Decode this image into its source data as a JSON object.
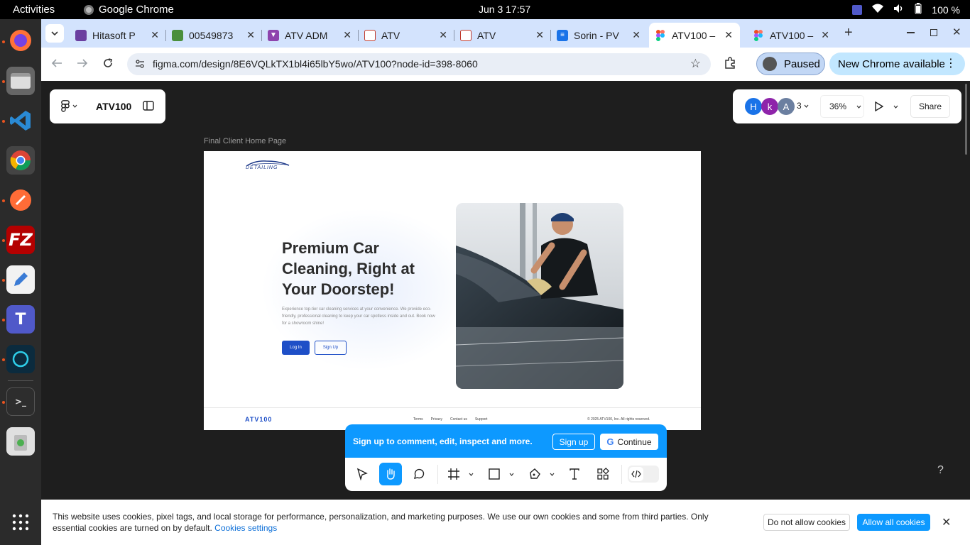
{
  "system": {
    "activities": "Activities",
    "app_name": "Google Chrome",
    "clock": "Jun 3  17:57",
    "battery": "100 %"
  },
  "tabs": [
    {
      "title": "Hitasoft P",
      "color": "#6b3fa0",
      "icon": "hitasoft-icon"
    },
    {
      "title": "00549873",
      "color": "#4a8f3c",
      "icon": "puzzle-icon"
    },
    {
      "title": "ATV ADM",
      "color": "#8e44ad",
      "icon": "vite-icon"
    },
    {
      "title": "ATV",
      "color": "#c0392b",
      "icon": "atv-icon"
    },
    {
      "title": "ATV",
      "color": "#c0392b",
      "icon": "atv-icon"
    },
    {
      "title": "Sorin - PV",
      "color": "#1a73e8",
      "icon": "docs-icon"
    },
    {
      "title": "ATV100 –",
      "color": "#f24e1e",
      "icon": "figma-icon"
    },
    {
      "title": "ATV100 –",
      "color": "#f24e1e",
      "icon": "figma-icon"
    }
  ],
  "address_bar": {
    "url": "figma.com/design/8E6VQLkTX1bl4i65lbY5wo/ATV100?node-id=398-8060"
  },
  "profile": {
    "paused_label": "Paused",
    "update_label": "New Chrome available"
  },
  "figma": {
    "file_name": "ATV100",
    "avatars": [
      {
        "letter": "H",
        "color": "#1a73e8"
      },
      {
        "letter": "k",
        "color": "#8e24aa"
      },
      {
        "letter": "A",
        "color": "#6b7fa0"
      }
    ],
    "avatar_count": "3",
    "zoom": "36%",
    "share_label": "Share",
    "help": "?"
  },
  "design_frame": {
    "label": "Final Client Home Page",
    "logo_text": "DETAILING",
    "hero_title": "Premium Car Cleaning, Right at Your Doorstep!",
    "hero_text": "Experience top-tier car cleaning services at your convenience. We provide eco-friendly, professional cleaning to keep your car spotless inside and out. Book now for a showroom shine!",
    "login_label": "Log In",
    "signup_label": "Sign Up",
    "footer_brand": "ATV100",
    "footer_links": [
      "Terms",
      "Privacy",
      "Contact us",
      "Support"
    ],
    "footer_copy": "© 2025 ATV100, Inc. All rights reserved."
  },
  "signup_prompt": {
    "text": "Sign up to comment, edit, inspect and more.",
    "signup_label": "Sign up",
    "continue_label": "Continue"
  },
  "cookies": {
    "message": "This website uses cookies, pixel tags, and local storage for performance, personalization, and marketing purposes. We use our own cookies and some from third parties. Only essential cookies are turned on by default.",
    "settings_link": "Cookies settings",
    "deny_label": "Do not allow cookies",
    "allow_label": "Allow all cookies"
  },
  "colors": {
    "figma_blue": "#0d99ff",
    "brand_blue": "#1e4fc7",
    "ubuntu_orange": "#e95420"
  }
}
